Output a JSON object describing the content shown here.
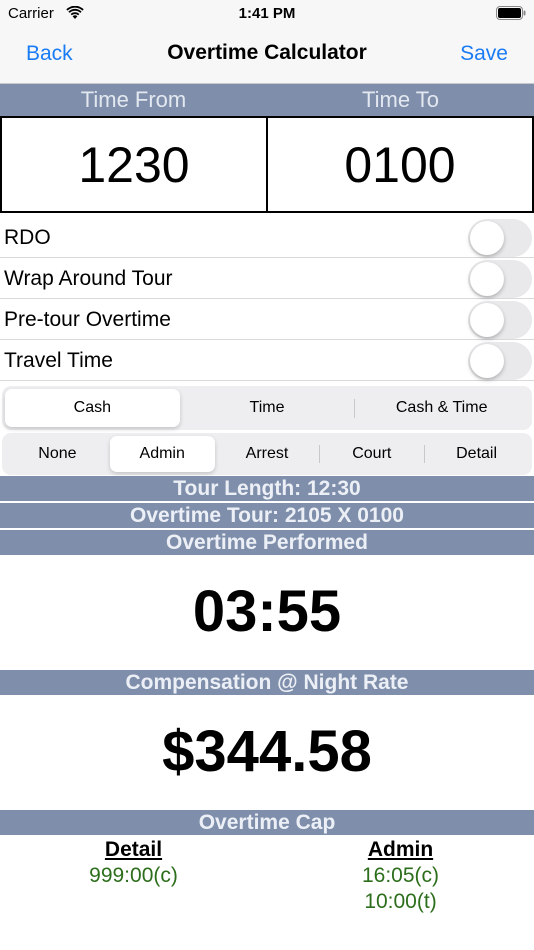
{
  "status_bar": {
    "carrier": "Carrier",
    "time": "1:41 PM"
  },
  "nav": {
    "back": "Back",
    "title": "Overtime Calculator",
    "save": "Save"
  },
  "time_header": {
    "from_label": "Time From",
    "to_label": "Time To"
  },
  "times": {
    "from": "1230",
    "to": "0100"
  },
  "toggles": [
    {
      "label": "RDO",
      "on": false
    },
    {
      "label": "Wrap Around Tour",
      "on": false
    },
    {
      "label": "Pre-tour Overtime",
      "on": false
    },
    {
      "label": "Travel Time",
      "on": false
    }
  ],
  "pay_type": {
    "options": [
      "Cash",
      "Time",
      "Cash & Time"
    ],
    "selected": "Cash"
  },
  "category": {
    "options": [
      "None",
      "Admin",
      "Arrest",
      "Court",
      "Detail"
    ],
    "selected": "Admin"
  },
  "summary": {
    "tour_length": "Tour Length: 12:30",
    "overtime_tour": "Overtime Tour: 2105 X 0100",
    "overtime_performed_label": "Overtime Performed",
    "overtime_performed": "03:55",
    "compensation_label": "Compensation @ Night Rate",
    "compensation": "$344.58",
    "cap_label": "Overtime Cap"
  },
  "cap": {
    "detail": {
      "title": "Detail",
      "values": [
        "999:00(c)"
      ]
    },
    "admin": {
      "title": "Admin",
      "values": [
        "16:05(c)",
        "10:00(t)"
      ]
    }
  },
  "colors": {
    "accent": "#1a7cf4",
    "band": "#7f8fab",
    "cap_value": "#2d6e1c"
  },
  "icons": {
    "wifi": "wifi-icon",
    "battery": "battery-icon"
  }
}
